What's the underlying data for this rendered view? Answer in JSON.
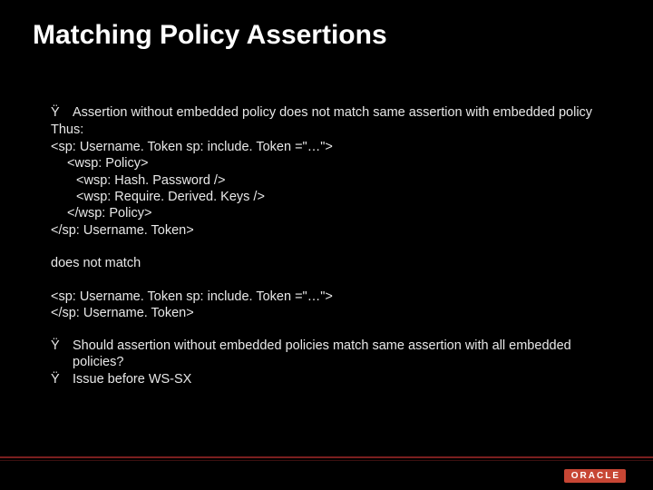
{
  "title": "Matching Policy Assertions",
  "bullet_char": "Ÿ",
  "bullets_top": [
    "Assertion without embedded policy does not match same assertion with embedded policy"
  ],
  "lines_block1": [
    {
      "indent": 0,
      "text": "Thus:"
    },
    {
      "indent": 0,
      "text": "<sp: Username. Token sp: include. Token =\"…\">"
    },
    {
      "indent": 1,
      "text": "<wsp: Policy>"
    },
    {
      "indent": 2,
      "text": "<wsp: Hash. Password />"
    },
    {
      "indent": 2,
      "text": "<wsp: Require. Derived. Keys />"
    },
    {
      "indent": 1,
      "text": "</wsp: Policy>"
    },
    {
      "indent": 0,
      "text": "</sp: Username. Token>"
    }
  ],
  "mid_text": "does not match",
  "lines_block2": [
    {
      "indent": 0,
      "text": "<sp: Username. Token sp: include. Token =\"…\">"
    },
    {
      "indent": 0,
      "text": "</sp: Username. Token>"
    }
  ],
  "bullets_bottom": [
    "Should assertion without embedded policies match same assertion with all embedded policies?",
    "Issue before WS-SX"
  ],
  "logo_text": "ORACLE"
}
